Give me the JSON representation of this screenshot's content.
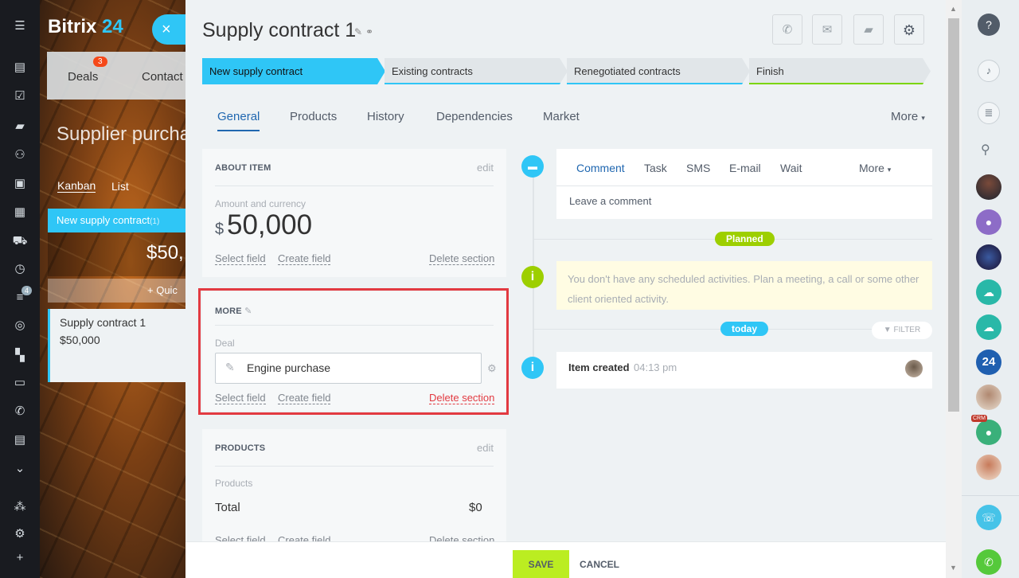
{
  "app": {
    "logo_text": "Bitrix",
    "logo_num": "24",
    "close_icon": "×"
  },
  "background": {
    "tabs": [
      {
        "label": "Deals",
        "badge": "3"
      },
      {
        "label": "Contact"
      }
    ],
    "page_title": "Supplier purcha",
    "view_kanban": "Kanban",
    "view_list": "List",
    "column_title": "New supply contract",
    "column_count": "(1)",
    "column_sum": "$50,",
    "quick_add": "+ Quic",
    "card": {
      "title": "Supply contract 1",
      "amount": "$50,000"
    }
  },
  "leftnav": {
    "badge": "4"
  },
  "slider": {
    "title": "Supply contract 1",
    "stages": [
      {
        "label": "New supply contract",
        "color": "#2fc6f6"
      },
      {
        "label": "Existing contracts",
        "color": "#e1e6e9"
      },
      {
        "label": "Renegotiated contracts",
        "color": "#e1e6e9"
      },
      {
        "label": "Finish",
        "color": "#e1e6e9"
      }
    ],
    "tabs": [
      "General",
      "Products",
      "History",
      "Dependencies",
      "Market"
    ],
    "tabs_more": "More",
    "about": {
      "header": "ABOUT ITEM",
      "edit": "edit",
      "amount_label": "Amount and currency",
      "currency": "$",
      "amount": "50,000",
      "select_field": "Select field",
      "create_field": "Create field",
      "delete_section": "Delete section"
    },
    "more": {
      "header": "MORE",
      "deal_label": "Deal",
      "deal_value": "Engine purchase",
      "select_field": "Select field",
      "create_field": "Create field",
      "delete_section": "Delete section"
    },
    "products": {
      "header": "PRODUCTS",
      "edit": "edit",
      "products_label": "Products",
      "total_label": "Total",
      "total_value": "$0",
      "select_field": "Select field",
      "create_field": "Create field",
      "delete_section": "Delete section"
    },
    "timeline": {
      "composer_tabs": [
        "Comment",
        "Task",
        "SMS",
        "E-mail",
        "Wait"
      ],
      "composer_more": "More",
      "composer_placeholder": "Leave a comment",
      "planned_badge": "Planned",
      "planned_text": "You don't have any scheduled activities. Plan a meeting, a call or some other client oriented activity.",
      "today_badge": "today",
      "filter_label": "FILTER",
      "item_title": "Item created",
      "item_time": "04:13 pm"
    },
    "footer": {
      "save": "SAVE",
      "cancel": "CANCEL"
    }
  },
  "rightbar": {
    "num_badge": "24",
    "crm_badge": "CRM"
  },
  "colors": {
    "accent": "#2fc6f6",
    "link_blue": "#2067b0",
    "save_green": "#bbed21",
    "danger": "#e23a41",
    "timeline_green": "#9dcf00"
  }
}
